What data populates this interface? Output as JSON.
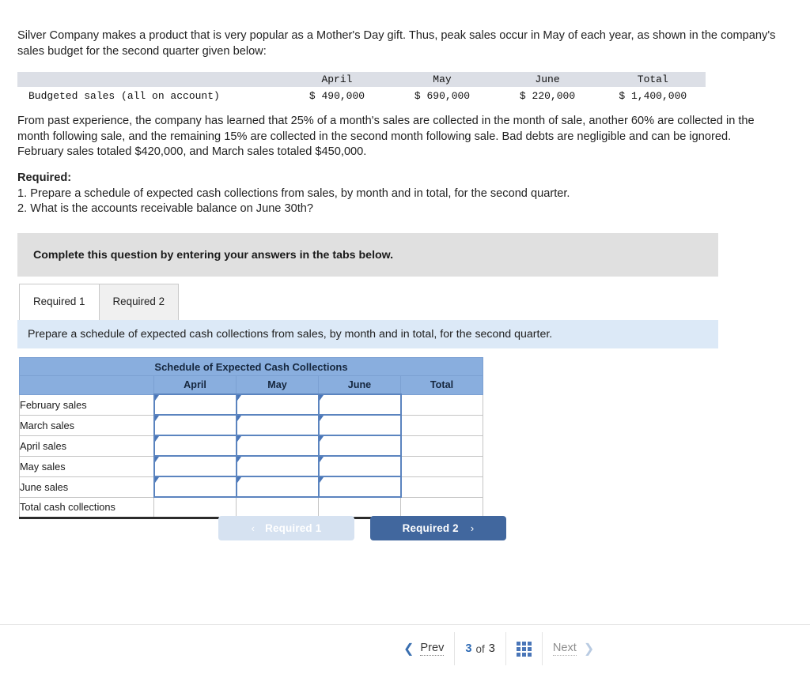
{
  "intro": {
    "paragraph": "Silver Company makes a product that is very popular as a Mother's Day gift. Thus, peak sales occur in May of each year, as shown in the company's sales budget for the second quarter given below:"
  },
  "budget_table": {
    "headers": [
      "",
      "April",
      "May",
      "June",
      "Total"
    ],
    "rows": [
      {
        "label": "Budgeted sales (all on account)",
        "april": "$ 490,000",
        "may": "$ 690,000",
        "june": "$ 220,000",
        "total": "$ 1,400,000"
      }
    ]
  },
  "collection_policy": {
    "paragraph": "From past experience, the company has learned that 25% of a month's sales are collected in the month of sale, another 60% are collected in the month following sale, and the remaining 15% are collected in the second month following sale. Bad debts are negligible and can be ignored. February sales totaled $420,000, and March sales totaled $450,000."
  },
  "required": {
    "heading": "Required:",
    "item1": "1. Prepare a schedule of expected cash collections from sales, by month and in total, for the second quarter.",
    "item2": "2. What is the accounts receivable balance on June 30th?"
  },
  "banner": {
    "text": "Complete this question by entering your answers in the tabs below."
  },
  "tabs": [
    {
      "label": "Required 1",
      "active": true
    },
    {
      "label": "Required 2",
      "active": false
    }
  ],
  "prompt": {
    "text": "Prepare a schedule of expected cash collections from sales, by month and in total, for the second quarter."
  },
  "schedule_table": {
    "title": "Schedule of Expected Cash Collections",
    "headers": [
      "",
      "April",
      "May",
      "June",
      "Total"
    ],
    "rows": [
      {
        "label": "February sales",
        "april": "",
        "may": "",
        "june": "",
        "total": ""
      },
      {
        "label": "March sales",
        "april": "",
        "may": "",
        "june": "",
        "total": ""
      },
      {
        "label": "April sales",
        "april": "",
        "may": "",
        "june": "",
        "total": ""
      },
      {
        "label": "May sales",
        "april": "",
        "may": "",
        "june": "",
        "total": ""
      },
      {
        "label": "June sales",
        "april": "",
        "may": "",
        "june": "",
        "total": ""
      },
      {
        "label": "Total cash collections",
        "april": "",
        "may": "",
        "june": "",
        "total": ""
      }
    ]
  },
  "req_nav": {
    "prev_label": "Required 1",
    "prev_chevron": "‹",
    "next_label": "Required 2",
    "next_chevron": "›"
  },
  "footer": {
    "prev_chevron": "❮",
    "prev_label": "Prev",
    "page_current": "3",
    "page_of": "of",
    "page_total": "3",
    "grid_icon": "grid-icon",
    "next_label": "Next",
    "next_chevron": "❯"
  },
  "colors": {
    "table_header_blue": "#89aede",
    "prompt_bar_blue": "#dce9f7",
    "banner_gray": "#e0e0e0",
    "primary_button": "#41679e",
    "disabled_button": "#d6e2f1",
    "input_border": "#5b84bf",
    "accent_link": "#2f6bb5"
  }
}
